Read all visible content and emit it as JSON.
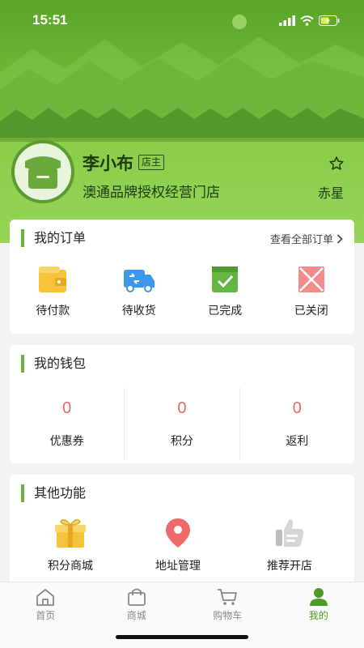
{
  "status_bar": {
    "time": "15:51"
  },
  "profile": {
    "name": "李小布",
    "role_badge": "店主",
    "shop_name": "澳通品牌授权经营门店",
    "tier": "赤星"
  },
  "orders": {
    "title": "我的订单",
    "view_all": "查看全部订单",
    "items": [
      {
        "label": "待付款",
        "icon": "wallet-icon",
        "color": "#f5c23a"
      },
      {
        "label": "待收货",
        "icon": "truck-icon",
        "color": "#3f97ec"
      },
      {
        "label": "已完成",
        "icon": "check-box-icon",
        "color": "#64b544"
      },
      {
        "label": "已关闭",
        "icon": "closed-box-icon",
        "color": "#f06a6a"
      }
    ]
  },
  "wallet": {
    "title": "我的钱包",
    "items": [
      {
        "value": "0",
        "label": "优惠券"
      },
      {
        "value": "0",
        "label": "积分"
      },
      {
        "value": "0",
        "label": "返利"
      }
    ]
  },
  "functions": {
    "title": "其他功能",
    "items": [
      {
        "label": "积分商城",
        "icon": "gift-icon",
        "color": "#f5c23a"
      },
      {
        "label": "地址管理",
        "icon": "location-pin-icon",
        "color": "#f06a6a"
      },
      {
        "label": "推荐开店",
        "icon": "thumbs-up-icon",
        "color": "#c8c8c8"
      }
    ]
  },
  "tabbar": {
    "items": [
      {
        "label": "首页",
        "icon": "home-icon",
        "active": false
      },
      {
        "label": "商城",
        "icon": "shopping-bag-icon",
        "active": false
      },
      {
        "label": "购物车",
        "icon": "cart-icon",
        "active": false
      },
      {
        "label": "我的",
        "icon": "person-icon",
        "active": true
      }
    ],
    "active_color": "#4f9a24"
  }
}
